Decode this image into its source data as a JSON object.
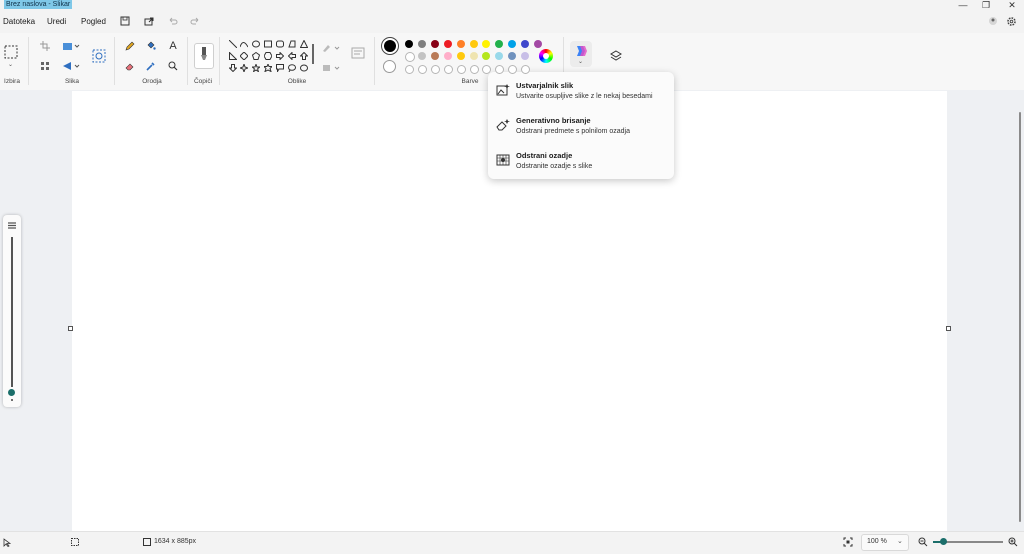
{
  "window": {
    "title": "Brez naslova - Slikar",
    "minimize_icon": "minimize-icon",
    "restore_icon": "restore-icon",
    "close_icon": "close-icon"
  },
  "menu": {
    "items": [
      "Datoteka",
      "Uredi",
      "Pogled"
    ]
  },
  "ribbon": {
    "groups": {
      "selection": "Izbira",
      "image": "Slika",
      "tools": "Orodja",
      "brushes": "Čopiči",
      "shapes": "Oblike",
      "colors": "Barve"
    }
  },
  "colors": {
    "primary": "#000000",
    "accent": "#1b6e6a",
    "row1": [
      "#000000",
      "#7f7f7f",
      "#880015",
      "#ed1c24",
      "#ff7f27",
      "#ffc90e",
      "#fff200",
      "#22b14c",
      "#00a2e8",
      "#3f48cc",
      "#a349a4"
    ],
    "row2": [
      "#ffffff",
      "#c3c3c3",
      "#b97a57",
      "#ffaec9",
      "#ffc90e",
      "#efe4b0",
      "#b5e61d",
      "#99d9ea",
      "#7092be",
      "#c8bfe7"
    ]
  },
  "dropdown": {
    "items": [
      {
        "title": "Ustvarjalnik slik",
        "desc": "Ustvarite osupljive slike z le nekaj besedami",
        "icon": "image-create-icon"
      },
      {
        "title": "Generativno brisanje",
        "desc": "Odstrani predmete s polnilom ozadja",
        "icon": "eraser-sparkle-icon"
      },
      {
        "title": "Odstrani ozadje",
        "desc": "Odstranite ozadje s slike",
        "icon": "remove-background-icon"
      }
    ]
  },
  "status": {
    "canvas_size": "1634 x 885px",
    "zoom": "100 %"
  }
}
